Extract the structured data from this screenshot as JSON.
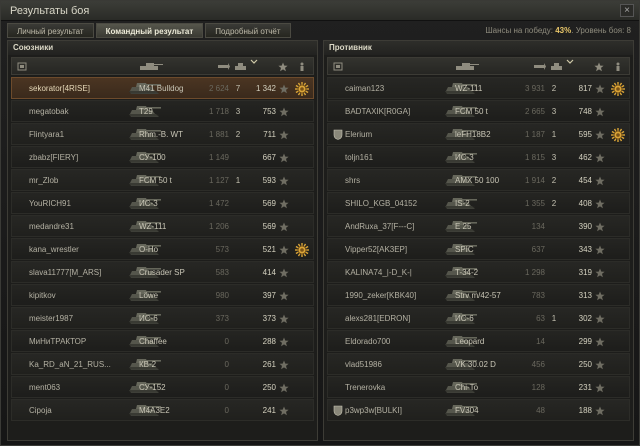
{
  "window": {
    "title": "Результаты боя",
    "close_label": "×"
  },
  "tabs": [
    {
      "label": "Личный результат"
    },
    {
      "label": "Командный результат"
    },
    {
      "label": "Подробный отчёт"
    }
  ],
  "summary": {
    "win_chance_label": "Шансы на победу: ",
    "win_chance_value": "43%",
    "battle_level_label": ". Уровень боя: 8"
  },
  "allies": {
    "title": "Союзники",
    "players": [
      {
        "name": "sekorator[4RISE]",
        "tank": "M41 Bulldog",
        "damage": "2 624",
        "kills": "7",
        "xp": "1 342",
        "medal": true,
        "badge": false,
        "current": true
      },
      {
        "name": "megatobak",
        "tank": "T29",
        "damage": "1 718",
        "kills": "3",
        "xp": "753",
        "medal": false,
        "badge": false,
        "current": false
      },
      {
        "name": "Flintyara1",
        "tank": "Rhm.-B. WT",
        "damage": "1 881",
        "kills": "2",
        "xp": "711",
        "medal": false,
        "badge": false,
        "current": false
      },
      {
        "name": "zbabz[FIERY]",
        "tank": "СУ-100",
        "damage": "1 149",
        "kills": "",
        "xp": "667",
        "medal": false,
        "badge": false,
        "current": false
      },
      {
        "name": "mr_Zlob",
        "tank": "FCM 50 t",
        "damage": "1 127",
        "kills": "1",
        "xp": "593",
        "medal": false,
        "badge": false,
        "current": false
      },
      {
        "name": "YouRICH91",
        "tank": "ИС-3",
        "damage": "1 472",
        "kills": "",
        "xp": "569",
        "medal": false,
        "badge": false,
        "current": false
      },
      {
        "name": "medandre31",
        "tank": "WZ-111",
        "damage": "1 206",
        "kills": "",
        "xp": "569",
        "medal": false,
        "badge": false,
        "current": false
      },
      {
        "name": "kana_wrestler",
        "tank": "O-Ho",
        "damage": "573",
        "kills": "",
        "xp": "521",
        "medal": true,
        "badge": false,
        "current": false
      },
      {
        "name": "slava11777[M_ARS]",
        "tank": "Crusader SP",
        "damage": "583",
        "kills": "",
        "xp": "414",
        "medal": false,
        "badge": false,
        "current": false
      },
      {
        "name": "kipitkov",
        "tank": "Löwe",
        "damage": "980",
        "kills": "",
        "xp": "397",
        "medal": false,
        "badge": false,
        "current": false
      },
      {
        "name": "meister1987",
        "tank": "ИС-6",
        "damage": "373",
        "kills": "",
        "xp": "373",
        "medal": false,
        "badge": false,
        "current": false
      },
      {
        "name": "МиНиТРАКТОР",
        "tank": "Chaffee",
        "damage": "0",
        "kills": "",
        "xp": "288",
        "medal": false,
        "badge": false,
        "current": false
      },
      {
        "name": "Ka_RD_aN_21_RUS...",
        "tank": "КВ-2",
        "damage": "0",
        "kills": "",
        "xp": "261",
        "medal": false,
        "badge": false,
        "current": false
      },
      {
        "name": "ment063",
        "tank": "СУ-152",
        "damage": "0",
        "kills": "",
        "xp": "250",
        "medal": false,
        "badge": false,
        "current": false
      },
      {
        "name": "Cipoja",
        "tank": "M4A3E2",
        "damage": "0",
        "kills": "",
        "xp": "241",
        "medal": false,
        "badge": false,
        "current": false
      }
    ]
  },
  "enemies": {
    "title": "Противник",
    "players": [
      {
        "name": "caiman123",
        "tank": "WZ-111",
        "damage": "3 931",
        "kills": "2",
        "xp": "817",
        "medal": true,
        "badge": false,
        "current": false
      },
      {
        "name": "BADTAXIK[R0GA]",
        "tank": "FCM 50 t",
        "damage": "2 665",
        "kills": "3",
        "xp": "748",
        "medal": false,
        "badge": false,
        "current": false
      },
      {
        "name": "Elerium",
        "tank": "leFH18B2",
        "damage": "1 187",
        "kills": "1",
        "xp": "595",
        "medal": true,
        "badge": true,
        "current": false
      },
      {
        "name": "toljn161",
        "tank": "ИС-3",
        "damage": "1 815",
        "kills": "3",
        "xp": "462",
        "medal": false,
        "badge": false,
        "current": false
      },
      {
        "name": "shrs",
        "tank": "AMX 50 100",
        "damage": "1 914",
        "kills": "2",
        "xp": "454",
        "medal": false,
        "badge": false,
        "current": false
      },
      {
        "name": "SHILO_KGB_04152",
        "tank": "IS-2",
        "damage": "1 355",
        "kills": "2",
        "xp": "408",
        "medal": false,
        "badge": false,
        "current": false
      },
      {
        "name": "AndRuxa_37[F---C]",
        "tank": "E 25",
        "damage": "134",
        "kills": "",
        "xp": "390",
        "medal": false,
        "badge": false,
        "current": false
      },
      {
        "name": "Vipper52[AK3EP]",
        "tank": "SPIC",
        "damage": "637",
        "kills": "",
        "xp": "343",
        "medal": false,
        "badge": false,
        "current": false
      },
      {
        "name": "KALINA74_|-D_K-|",
        "tank": "T-34-2",
        "damage": "1 298",
        "kills": "",
        "xp": "319",
        "medal": false,
        "badge": false,
        "current": false
      },
      {
        "name": "1990_zeker[KBK40]",
        "tank": "Strv m/42-57",
        "damage": "783",
        "kills": "",
        "xp": "313",
        "medal": false,
        "badge": false,
        "current": false
      },
      {
        "name": "alexs281[EDRON]",
        "tank": "ИС-6",
        "damage": "63",
        "kills": "1",
        "xp": "302",
        "medal": false,
        "badge": false,
        "current": false
      },
      {
        "name": "Eldorado700",
        "tank": "Leopard",
        "damage": "14",
        "kills": "",
        "xp": "299",
        "medal": false,
        "badge": false,
        "current": false
      },
      {
        "name": "vlad51986",
        "tank": "VK 30.02 D",
        "damage": "456",
        "kills": "",
        "xp": "250",
        "medal": false,
        "badge": false,
        "current": false
      },
      {
        "name": "Trenerovka",
        "tank": "Chi-To",
        "damage": "128",
        "kills": "",
        "xp": "231",
        "medal": false,
        "badge": false,
        "current": false
      },
      {
        "name": "p3wp3w[BULKI]",
        "tank": "FV304",
        "damage": "48",
        "kills": "",
        "xp": "188",
        "medal": false,
        "badge": true,
        "current": false
      }
    ]
  },
  "colors": {
    "accent": "#e8c66a",
    "highlight_row": "#4b3522",
    "medal": "#d9a437"
  }
}
